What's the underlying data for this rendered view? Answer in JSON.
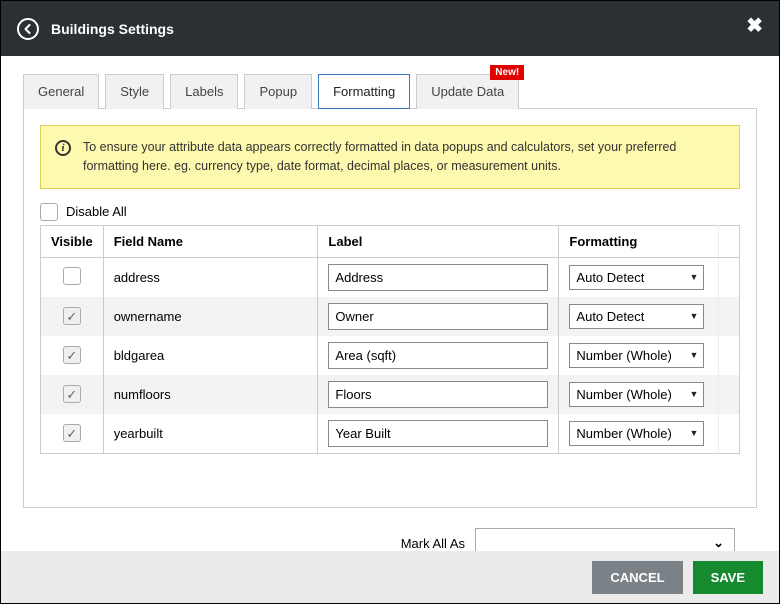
{
  "header": {
    "title": "Buildings Settings"
  },
  "tabs": [
    {
      "label": "General"
    },
    {
      "label": "Style"
    },
    {
      "label": "Labels"
    },
    {
      "label": "Popup"
    },
    {
      "label": "Formatting"
    },
    {
      "label": "Update Data",
      "badge": "New!"
    }
  ],
  "info": "To ensure your attribute data appears correctly formatted in data popups and calculators, set your preferred formatting here. eg. currency type, date format, decimal places, or measurement units.",
  "disable_all_label": "Disable All",
  "columns": {
    "visible": "Visible",
    "field": "Field Name",
    "label": "Label",
    "formatting": "Formatting"
  },
  "rows": [
    {
      "visible": false,
      "field": "address",
      "label": "Address",
      "formatting": "Auto Detect"
    },
    {
      "visible": true,
      "field": "ownername",
      "label": "Owner",
      "formatting": "Auto Detect"
    },
    {
      "visible": true,
      "field": "bldgarea",
      "label": "Area (sqft)",
      "formatting": "Number (Whole)"
    },
    {
      "visible": true,
      "field": "numfloors",
      "label": "Floors",
      "formatting": "Number (Whole)"
    },
    {
      "visible": true,
      "field": "yearbuilt",
      "label": "Year Built",
      "formatting": "Number (Whole)"
    }
  ],
  "mark_all_label": "Mark All As",
  "buttons": {
    "cancel": "CANCEL",
    "save": "SAVE"
  }
}
